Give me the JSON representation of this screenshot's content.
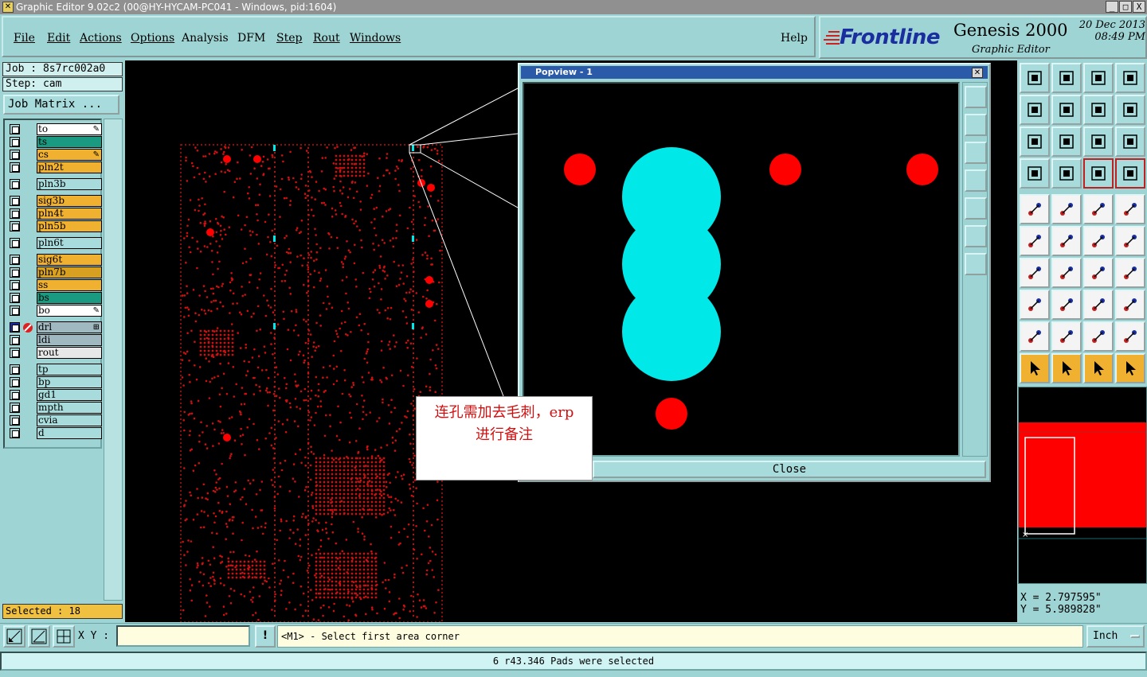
{
  "window": {
    "title": "Graphic Editor 9.02c2 (00@HY-HYCAM-PC041 - Windows, pid:1604)",
    "minimize": "_",
    "maximize": "□",
    "close": "X"
  },
  "menu": [
    {
      "label": "File"
    },
    {
      "label": "Edit"
    },
    {
      "label": "Actions"
    },
    {
      "label": "Options"
    },
    {
      "label": "Analysis"
    },
    {
      "label": "DFM"
    },
    {
      "label": "Step"
    },
    {
      "label": "Rout"
    },
    {
      "label": "Windows"
    },
    {
      "label": "Help"
    }
  ],
  "brand": {
    "logo": "Frontline",
    "product": "Genesis 2000",
    "date": "20 Dec 2013",
    "time": "08:49 PM",
    "subtitle": "Graphic Editor",
    "brand_color": "#1a2ea0"
  },
  "job": {
    "job_line": "Job : 8s7rc002a0",
    "step_line": "Step: cam",
    "matrix_button": "Job Matrix ..."
  },
  "layers": [
    {
      "name": "to",
      "color": "#ffffff",
      "mark": "✎"
    },
    {
      "name": "ts",
      "color": "#1a9a80",
      "mark": ""
    },
    {
      "name": "cs",
      "color": "#f0b030",
      "mark": "✎"
    },
    {
      "name": "pln2t",
      "color": "#f0b030",
      "mark": ""
    },
    {
      "name": "pln3b",
      "color": "#a8dcdc",
      "mark": ""
    },
    {
      "name": "sig3b",
      "color": "#f0b030",
      "mark": ""
    },
    {
      "name": "pln4t",
      "color": "#f0b030",
      "mark": ""
    },
    {
      "name": "pln5b",
      "color": "#f0b030",
      "mark": ""
    },
    {
      "name": "pln6t",
      "color": "#a8dcdc",
      "mark": ""
    },
    {
      "name": "sig6t",
      "color": "#f0b030",
      "mark": ""
    },
    {
      "name": "pln7b",
      "color": "#d8a020",
      "mark": ""
    },
    {
      "name": "ss",
      "color": "#f0b030",
      "mark": ""
    },
    {
      "name": "bs",
      "color": "#1a9a80",
      "mark": ""
    },
    {
      "name": "bo",
      "color": "#ffffff",
      "mark": "✎"
    },
    {
      "name": "drl",
      "color": "#a0b8c0",
      "mark": "⊞"
    },
    {
      "name": "ldi",
      "color": "#a0b8c0",
      "mark": ""
    },
    {
      "name": "rout",
      "color": "#e8e8e8",
      "mark": ""
    },
    {
      "name": "tp",
      "color": "#a8dcdc",
      "mark": ""
    },
    {
      "name": "bp",
      "color": "#a8dcdc",
      "mark": ""
    },
    {
      "name": "gd1",
      "color": "#a8dcdc",
      "mark": ""
    },
    {
      "name": "mpth",
      "color": "#a8dcdc",
      "mark": ""
    },
    {
      "name": "cvia",
      "color": "#a8dcdc",
      "mark": ""
    },
    {
      "name": "d",
      "color": "#a8dcdc",
      "mark": ""
    }
  ],
  "selected": "Selected : 18",
  "popview": {
    "title": "Popview - 1",
    "close_button": "Close"
  },
  "note": {
    "line1": "连孔需加去毛刺，erp",
    "line2": "进行备注"
  },
  "coords": {
    "x": "X = 2.797595\"",
    "y": "Y = 5.989828\""
  },
  "bottom": {
    "xy_label": "X Y :",
    "xy_value": "",
    "warn": "!",
    "prompt": "<M1> - Select first area corner",
    "units": "Inch",
    "status": "6 r43.346 Pads were selected"
  },
  "colors": {
    "pad_red": "#ff0000",
    "selected_cyan": "#00e8e8",
    "panel_bg": "#9fd4d4"
  }
}
